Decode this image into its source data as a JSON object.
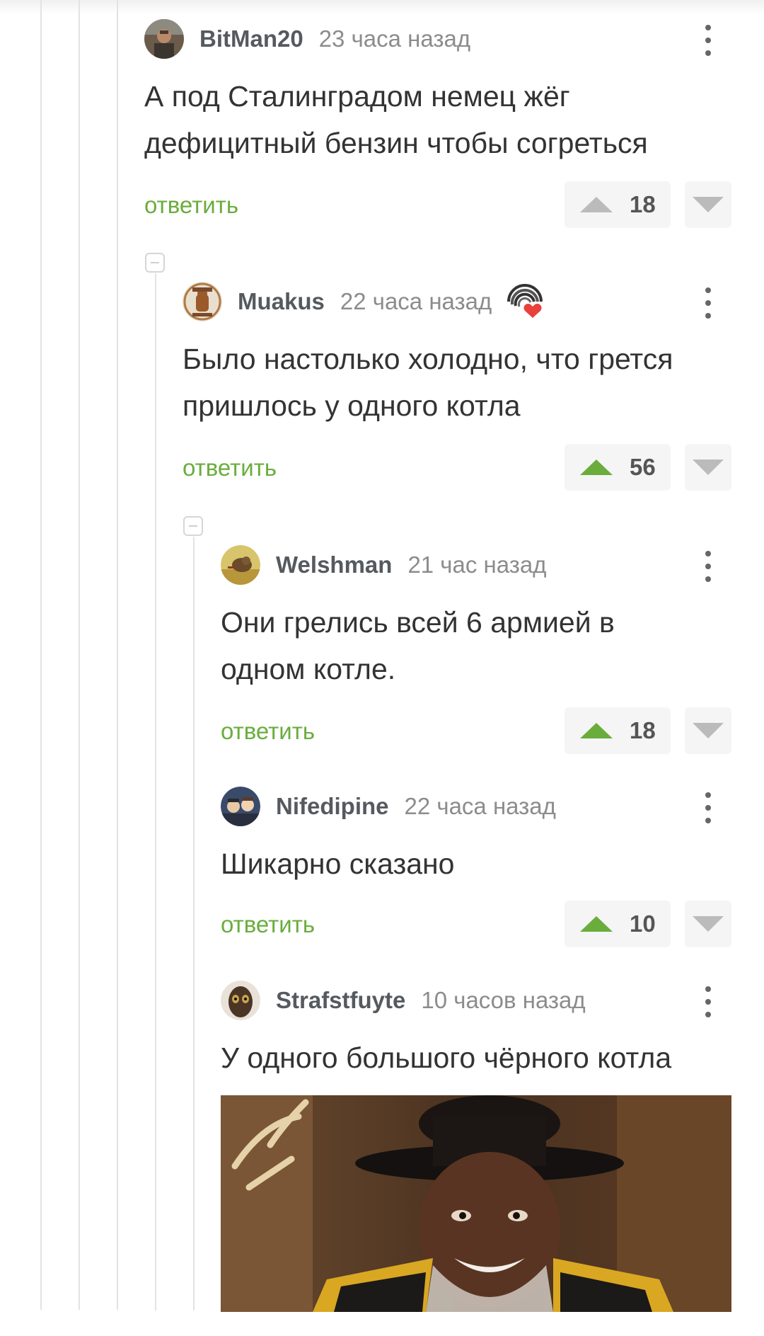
{
  "colors": {
    "accent_green": "#6aad3d",
    "text": "#333333",
    "muted": "#8c8c8c",
    "thread_line": "#e3e3e3"
  },
  "comments": [
    {
      "author": "BitMan20",
      "time": "23 часа назад",
      "text": "А под Сталинградом немец жёг дефицитный бензин чтобы согреться",
      "reply_label": "ответить",
      "votes": "18",
      "upvoted": false,
      "avatar_icon": "user-avatar-icon",
      "menu_icon": "kebab-menu-icon"
    },
    {
      "author": "Muakus",
      "time": "22 часа назад",
      "text": "Было настолько холодно, что грется пришлось у одного котла",
      "reply_label": "ответить",
      "votes": "56",
      "upvoted": true,
      "avatar_icon": "user-avatar-icon",
      "badge_icon": "heart-badge-icon",
      "menu_icon": "kebab-menu-icon"
    },
    {
      "author": "Welshman",
      "time": "21 час назад",
      "text": "Они грелись всей 6 армией в одном котле.",
      "reply_label": "ответить",
      "votes": "18",
      "upvoted": true,
      "avatar_icon": "user-avatar-icon",
      "menu_icon": "kebab-menu-icon"
    },
    {
      "author": "Nifedipine",
      "time": "22 часа назад",
      "text": "Шикарно сказано",
      "reply_label": "ответить",
      "votes": "10",
      "upvoted": true,
      "avatar_icon": "user-avatar-icon",
      "menu_icon": "kebab-menu-icon"
    },
    {
      "author": "Strafstfuyte",
      "time": "10 часов назад",
      "text": "У одного большого чёрного котла",
      "avatar_icon": "user-avatar-icon",
      "menu_icon": "kebab-menu-icon",
      "attachment": "photo-attachment"
    }
  ]
}
